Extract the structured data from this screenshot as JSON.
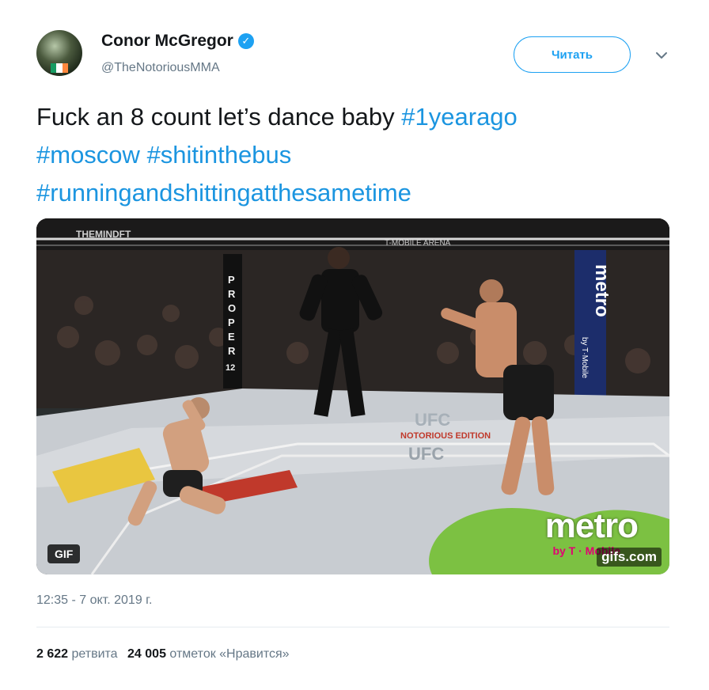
{
  "author": {
    "name": "Conor McGregor",
    "handle": "@TheNotoriousMMA",
    "verified": true
  },
  "follow_button": {
    "label": "Читать"
  },
  "tweet": {
    "text_plain": "Fuck an 8 count let’s dance baby ",
    "hashtags": [
      "#1yearago",
      "#moscow",
      "#shitinthebus",
      "#runningandshittingatthesametime"
    ]
  },
  "media": {
    "badge": "GIF",
    "watermark_main": "metro",
    "watermark_sub": "by T · Mobile",
    "watermark_site": "gifs.com",
    "scene_texts": {
      "cage_sign_left": "THEMINDFT",
      "arena": "T-MOBILE ARENA",
      "pole_sign": [
        "P",
        "R",
        "O",
        "P",
        "E",
        "R",
        "12"
      ],
      "banner_metro": "metro",
      "banner_by": "by T·Mobile",
      "ufc_1": "UFC",
      "ufc_2": "UFC",
      "mat_text": "NOTORIOUS EDITION"
    }
  },
  "timestamp": "12:35 - 7 окт. 2019 г.",
  "stats": {
    "retweets_count": "2 622",
    "retweets_label": "ретвита",
    "likes_count": "24 005",
    "likes_label": "отметок «Нравится»"
  },
  "colors": {
    "accent": "#1da1f2",
    "hashtag": "#1b95e0",
    "muted": "#657786",
    "text": "#14171a"
  }
}
